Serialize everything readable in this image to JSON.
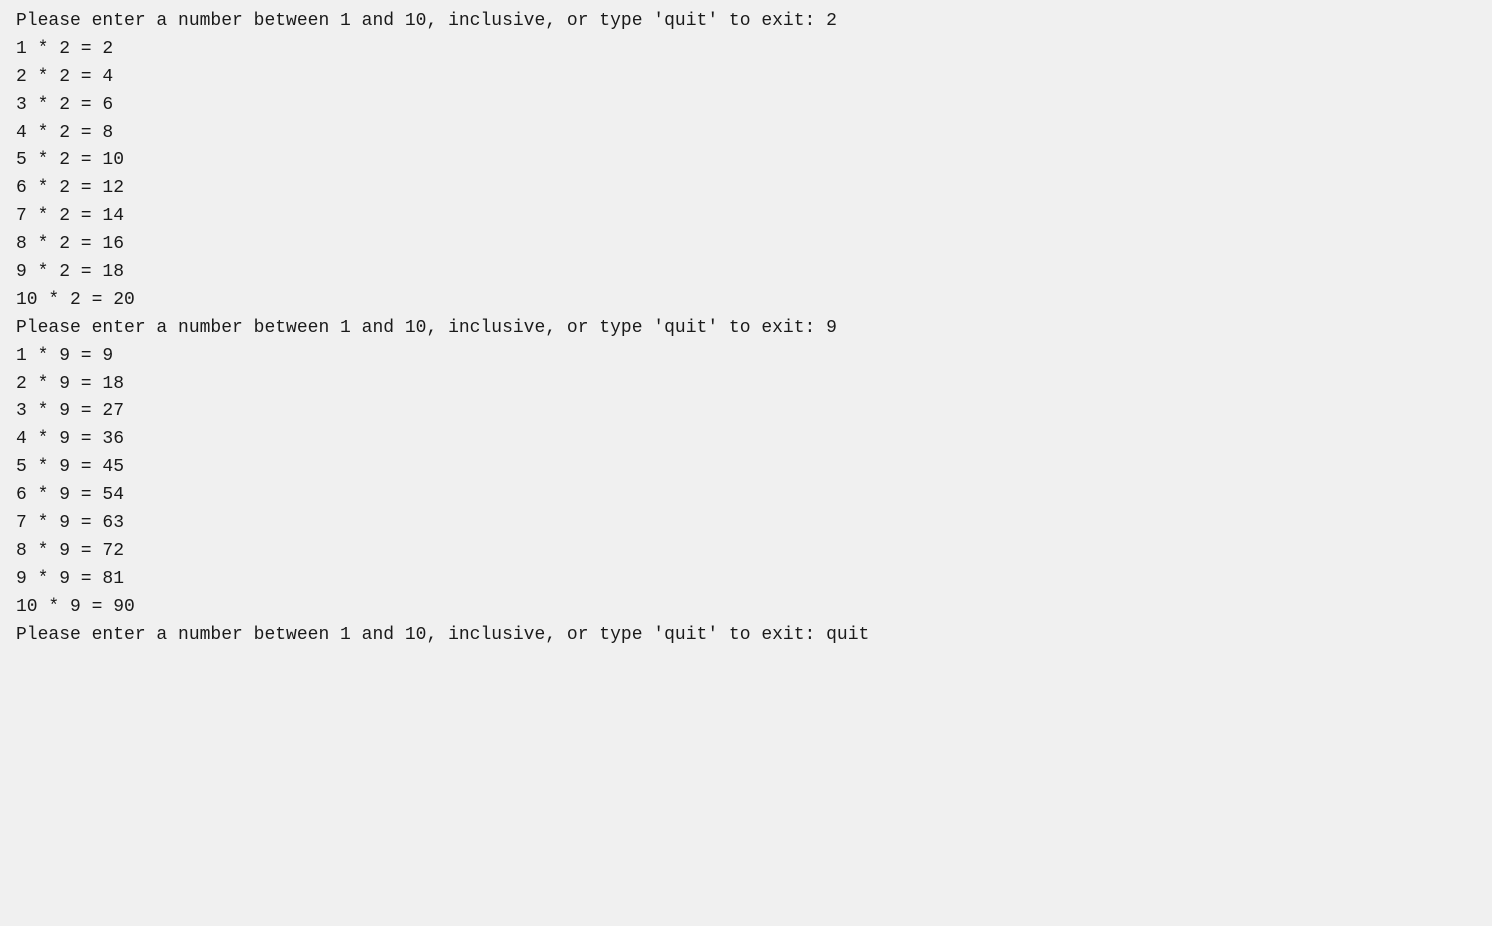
{
  "terminal": {
    "lines": [
      "Please enter a number between 1 and 10, inclusive, or type 'quit' to exit: 2",
      "1 * 2 = 2",
      "2 * 2 = 4",
      "3 * 2 = 6",
      "4 * 2 = 8",
      "5 * 2 = 10",
      "6 * 2 = 12",
      "7 * 2 = 14",
      "8 * 2 = 16",
      "9 * 2 = 18",
      "10 * 2 = 20",
      "Please enter a number between 1 and 10, inclusive, or type 'quit' to exit: 9",
      "1 * 9 = 9",
      "2 * 9 = 18",
      "3 * 9 = 27",
      "4 * 9 = 36",
      "5 * 9 = 45",
      "6 * 9 = 54",
      "7 * 9 = 63",
      "8 * 9 = 72",
      "9 * 9 = 81",
      "10 * 9 = 90",
      "Please enter a number between 1 and 10, inclusive, or type 'quit' to exit: quit"
    ]
  }
}
